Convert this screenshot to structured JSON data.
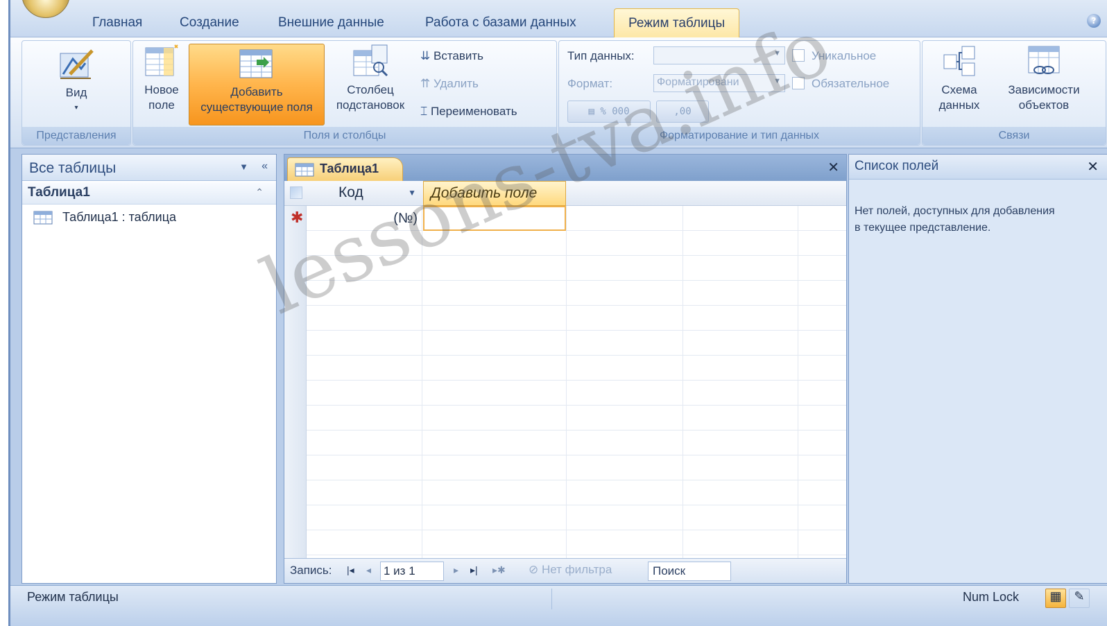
{
  "tabs": [
    {
      "label": "Главная"
    },
    {
      "label": "Создание"
    },
    {
      "label": "Внешние данные"
    },
    {
      "label": "Работа с базами данных"
    },
    {
      "label": "Режим таблицы",
      "active": true
    }
  ],
  "ribbon": {
    "view": {
      "label": "Вид",
      "group": "Представления"
    },
    "fields": {
      "group": "Поля и столбцы",
      "new_field": [
        "Новое",
        "поле"
      ],
      "add_existing": [
        "Добавить",
        "существующие поля"
      ],
      "lookup": [
        "Столбец",
        "подстановок"
      ],
      "insert": "Вставить",
      "delete": "Удалить",
      "rename": "Переименовать"
    },
    "format": {
      "group": "Форматирование и тип данных",
      "data_type_label": "Тип данных:",
      "data_type_value": "",
      "format_label": "Формат:",
      "format_value": "Форматировани",
      "unique_label": "Уникальное",
      "required_label": "Обязательное",
      "buttons": [
        "%",
        "000",
        ",00"
      ]
    },
    "relations": {
      "group": "Связи",
      "schema": [
        "Схема",
        "данных"
      ],
      "deps": [
        "Зависимости",
        "объектов"
      ]
    }
  },
  "nav": {
    "header": "Все таблицы",
    "group": "Таблица1",
    "item": "Таблица1 : таблица"
  },
  "document": {
    "tab": "Таблица1",
    "columns": [
      "Код",
      "Добавить поле"
    ],
    "new_row_value": "(№)",
    "status": {
      "records_label": "Запись:",
      "record_pos": "1 из 1",
      "filter": "Нет фильтра",
      "search": "Поиск"
    }
  },
  "field_list": {
    "title": "Список полей",
    "message": "Нет полей, доступных для добавления в текущее представление."
  },
  "statusbar": {
    "mode": "Режим таблицы",
    "numlock": "Num Lock"
  },
  "watermark": "lessons-tva.info"
}
